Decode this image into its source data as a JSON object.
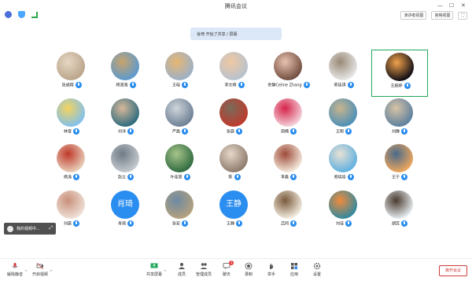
{
  "window": {
    "title": "腾讯会议",
    "minimize": "—",
    "restore": "☐",
    "close": "✕"
  },
  "header_buttons": {
    "speaker_view": "演讲者视图",
    "gallery_view": "宫格视图"
  },
  "banner": {
    "text": "肖琦 开始了共享 / 屏幕"
  },
  "participants": [
    {
      "name": "张成翔",
      "avatar_type": "image",
      "colors": [
        "#b9a48a",
        "#e6d7c3"
      ]
    },
    {
      "name": "杨润海",
      "avatar_type": "image",
      "colors": [
        "#5a9ad1",
        "#c9a36b"
      ]
    },
    {
      "name": "王晓",
      "avatar_type": "image",
      "colors": [
        "#9bb1c9",
        "#e7b672"
      ]
    },
    {
      "name": "李文晴",
      "avatar_type": "image",
      "colors": [
        "#b7c2cf",
        "#f0c8a2"
      ]
    },
    {
      "name": "余静Celine Zhang",
      "avatar_type": "image",
      "colors": [
        "#6f4c3e",
        "#e9c2b1"
      ]
    },
    {
      "name": "郭佳琪",
      "avatar_type": "image",
      "colors": [
        "#e8e8e8",
        "#9a8a77"
      ]
    },
    {
      "name": "王婉婷",
      "avatar_type": "image",
      "colors": [
        "#0b0b14",
        "#f2a24b"
      ]
    },
    {
      "name": "林雪",
      "avatar_type": "image",
      "colors": [
        "#7fc0ee",
        "#f4d35e"
      ]
    },
    {
      "name": "刘洋",
      "avatar_type": "image",
      "colors": [
        "#2b6a7e",
        "#d9b89a"
      ]
    },
    {
      "name": "严磊",
      "avatar_type": "image",
      "colors": [
        "#6c7f93",
        "#cfd5db"
      ]
    },
    {
      "name": "张晨",
      "avatar_type": "image",
      "colors": [
        "#c0392b",
        "#7a6b5b"
      ]
    },
    {
      "name": "周楠",
      "avatar_type": "image",
      "colors": [
        "#f4d4dc",
        "#d6244a"
      ]
    },
    {
      "name": "王刚",
      "avatar_type": "image",
      "colors": [
        "#4a8fb8",
        "#c8b48c"
      ]
    },
    {
      "name": "刘静",
      "avatar_type": "image",
      "colors": [
        "#5b7f9e",
        "#d8c3a6"
      ]
    },
    {
      "name": "杨涛",
      "avatar_type": "image",
      "colors": [
        "#e9d2bd",
        "#c0392b"
      ]
    },
    {
      "name": "赵立",
      "avatar_type": "image",
      "colors": [
        "#c6cbd0",
        "#6f7b86"
      ]
    },
    {
      "name": "叶佳慧",
      "avatar_type": "image",
      "colors": [
        "#2e6a3f",
        "#a7c48a"
      ]
    },
    {
      "name": "陈",
      "avatar_type": "image",
      "colors": [
        "#8c7a6b",
        "#e6d8c9"
      ]
    },
    {
      "name": "李鑫",
      "avatar_type": "image",
      "colors": [
        "#f5ecdf",
        "#9e4b3a"
      ]
    },
    {
      "name": "郑晓培",
      "avatar_type": "image",
      "colors": [
        "#5fb0e0",
        "#e8e1d4"
      ]
    },
    {
      "name": "王宁",
      "avatar_type": "image",
      "colors": [
        "#f0a85c",
        "#4a6a8a"
      ]
    },
    {
      "name": "刘晨",
      "avatar_type": "image",
      "colors": [
        "#efe2d9",
        "#c9907a"
      ]
    },
    {
      "name": "肖琦",
      "avatar_type": "text",
      "text": "肖琦"
    },
    {
      "name": "张宏",
      "avatar_type": "image",
      "colors": [
        "#b5a17c",
        "#6d8aa4"
      ]
    },
    {
      "name": "王静",
      "avatar_type": "text",
      "text": "王静"
    },
    {
      "name": "吕同",
      "avatar_type": "image",
      "colors": [
        "#f5efe3",
        "#7a5a3c"
      ]
    },
    {
      "name": "刘佳",
      "avatar_type": "image",
      "colors": [
        "#2f8aa0",
        "#f08a3c"
      ]
    },
    {
      "name": "胡蕊",
      "avatar_type": "image",
      "colors": [
        "#e8eef2",
        "#4a3b30"
      ]
    }
  ],
  "selfview": {
    "label": "我的视频中..."
  },
  "toolbar": {
    "mute": "解除静音",
    "video": "开启视频",
    "share": "共享屏幕",
    "members": "成员",
    "manage": "管理成员",
    "chat": "聊天",
    "record": "录制",
    "raise": "举手",
    "apps": "应用",
    "settings": "设置",
    "chat_badge": "1",
    "leave": "离开会议"
  },
  "colors": {
    "accent": "#2a8df0",
    "leave": "#d23a3a",
    "highlight": "#1fa85a"
  }
}
